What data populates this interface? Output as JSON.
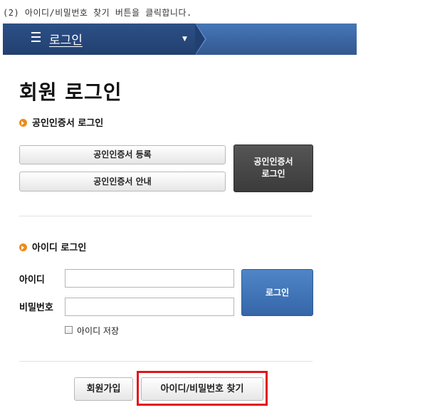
{
  "caption": "(2) 아이디/비밀번호 찾기 버튼을 클릭합니다.",
  "nav": {
    "menu_icon": "hamburger-icon",
    "title": "로그인",
    "dropdown_icon": "triangle-down-icon"
  },
  "page_title": "회원 로그인",
  "cert_section": {
    "heading": "공인인증서 로그인",
    "register_button": "공인인증서 등록",
    "guide_button": "공인인증서 안내",
    "login_button_line1": "공인인증서",
    "login_button_line2": "로그인"
  },
  "id_section": {
    "heading": "아이디 로그인",
    "id_label": "아이디",
    "password_label": "비밀번호",
    "id_value": "",
    "password_value": "",
    "login_button": "로그인",
    "save_id_label": "아이디 저장",
    "save_id_checked": false
  },
  "bottom": {
    "join_button": "회원가입",
    "find_button": "아이디/비밀번호 찾기"
  },
  "colors": {
    "nav": "#33588f",
    "accent_bullet": "#f08a18",
    "highlight": "#e0141c",
    "login_blue": "#3566a8"
  }
}
